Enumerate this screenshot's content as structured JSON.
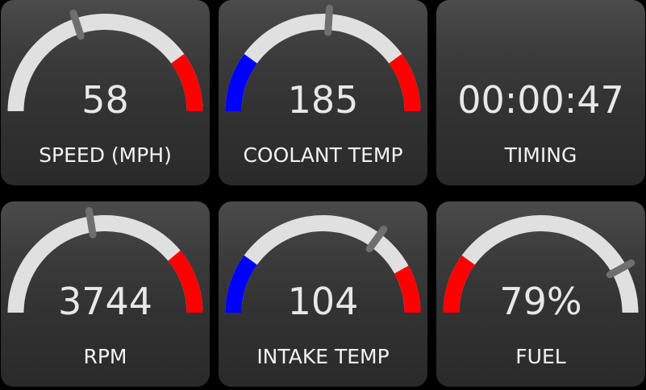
{
  "colors": {
    "background": "#000000",
    "tile_top": "#4b4b4b",
    "tile_bottom": "#2a2a2a",
    "arc_track": "#e0e0e0",
    "needle": "#6f6f6f",
    "cold_zone": "#0000ff",
    "hot_zone": "#ff0000",
    "text": "#f0f0f0"
  },
  "gauges": [
    {
      "id": "speed",
      "value": "58",
      "label": "SPEED (MPH)",
      "needle_fraction": 0.4,
      "cold_zone_fraction": 0,
      "hot_zone_start_fraction": 0.8,
      "low_red_end_fraction": 0
    },
    {
      "id": "coolant",
      "value": "185",
      "label": "COOLANT TEMP",
      "needle_fraction": 0.52,
      "cold_zone_fraction": 0.2,
      "hot_zone_start_fraction": 0.8,
      "low_red_end_fraction": 0
    },
    {
      "id": "timing",
      "value": "00:00:47",
      "label": "TIMING",
      "needle_fraction": null,
      "cold_zone_fraction": 0,
      "hot_zone_start_fraction": 1,
      "low_red_end_fraction": 0
    },
    {
      "id": "rpm",
      "value": "3744",
      "label": "RPM",
      "needle_fraction": 0.45,
      "cold_zone_fraction": 0,
      "hot_zone_start_fraction": 0.78,
      "low_red_end_fraction": 0
    },
    {
      "id": "intake",
      "value": "104",
      "label": "INTAKE TEMP",
      "needle_fraction": 0.7,
      "cold_zone_fraction": 0.2,
      "hot_zone_start_fraction": 0.84,
      "low_red_end_fraction": 0
    },
    {
      "id": "fuel",
      "value": "79%",
      "label": "FUEL",
      "needle_fraction": 0.84,
      "cold_zone_fraction": 0,
      "hot_zone_start_fraction": 1,
      "low_red_end_fraction": 0.2
    }
  ]
}
